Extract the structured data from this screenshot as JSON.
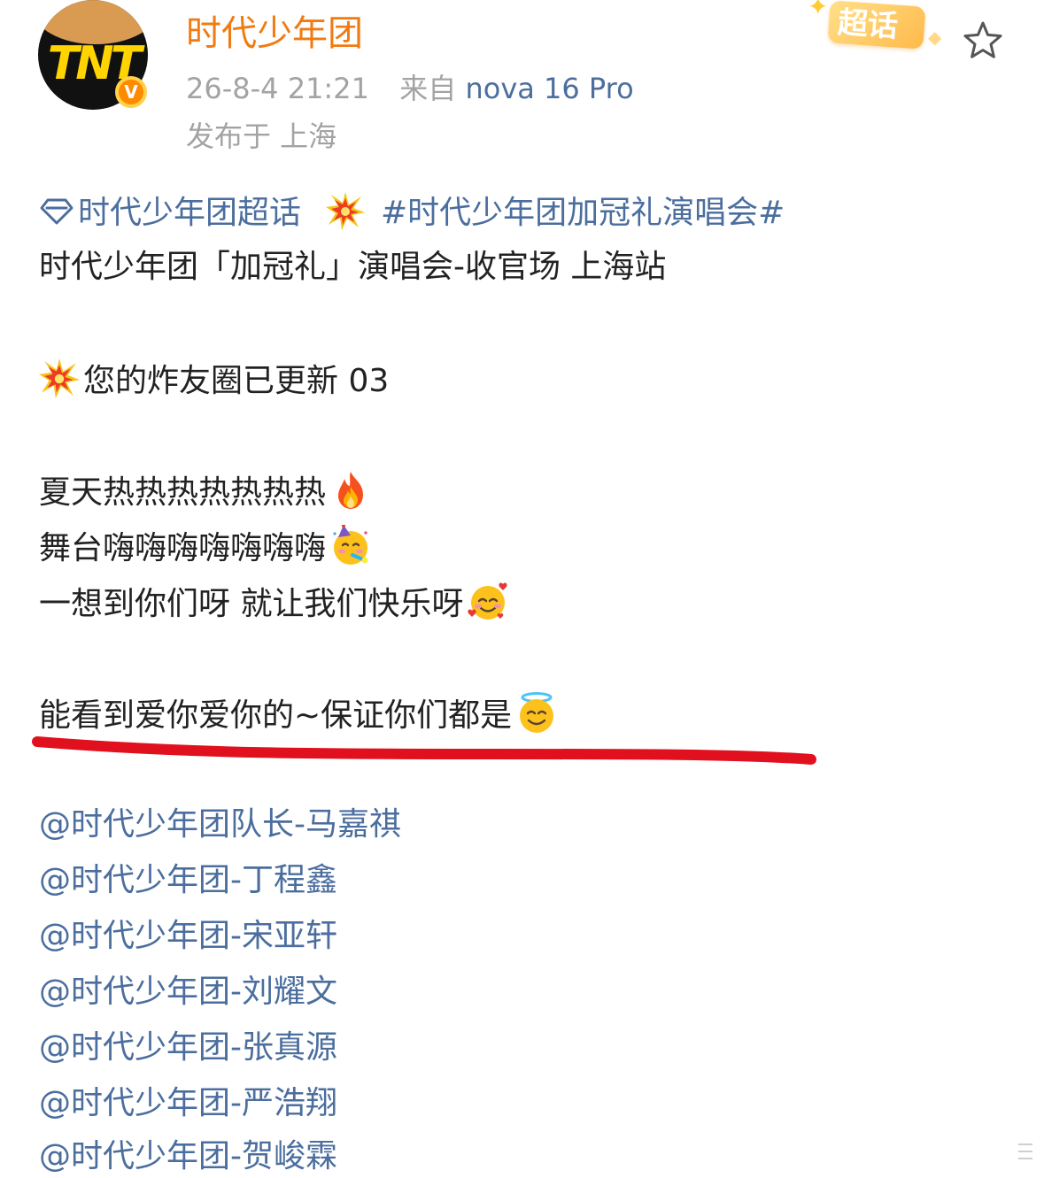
{
  "header": {
    "avatar_logo": "TNT",
    "verified_mark": "V",
    "user_name": "时代少年团",
    "timestamp": "26-8-4 21:21",
    "source_prefix": "来自",
    "device": "nova 16 Pro",
    "location": "发布于 上海",
    "supertopic_badge": "超话",
    "favorite_icon": "star-outline-icon"
  },
  "post": {
    "topic_link": "时代少年团超话",
    "hashtag": "#时代少年团加冠礼演唱会#",
    "title_line": "时代少年团「加冠礼」演唱会-收官场 上海站",
    "update_line": "您的炸友圈已更新  03",
    "line_summer": "夏天热热热热热热热",
    "line_stage": "舞台嗨嗨嗨嗨嗨嗨嗨",
    "line_happy": "一想到你们呀 就让我们快乐呀",
    "line_love": "能看到爱你爱你的~保证你们都是",
    "icons": {
      "topic": "supertopic-diamond-icon",
      "boom": "collision-emoji",
      "fire": "fire-emoji",
      "party": "partying-face-emoji",
      "hearts": "smiling-face-with-hearts-emoji",
      "halo": "smiling-face-with-halo-emoji"
    },
    "mentions": [
      "@时代少年团队长-马嘉祺",
      "@时代少年团-丁程鑫",
      "@时代少年团-宋亚轩",
      "@时代少年团-刘耀文",
      "@时代少年团-张真源",
      "@时代少年团-严浩翔",
      "@时代少年团-贺峻霖"
    ]
  },
  "colors": {
    "user_name": "#f07b12",
    "link": "#4b6e9e",
    "meta": "#a3a3a3",
    "body_text": "#222222",
    "highlight_underline": "#e0101e"
  }
}
